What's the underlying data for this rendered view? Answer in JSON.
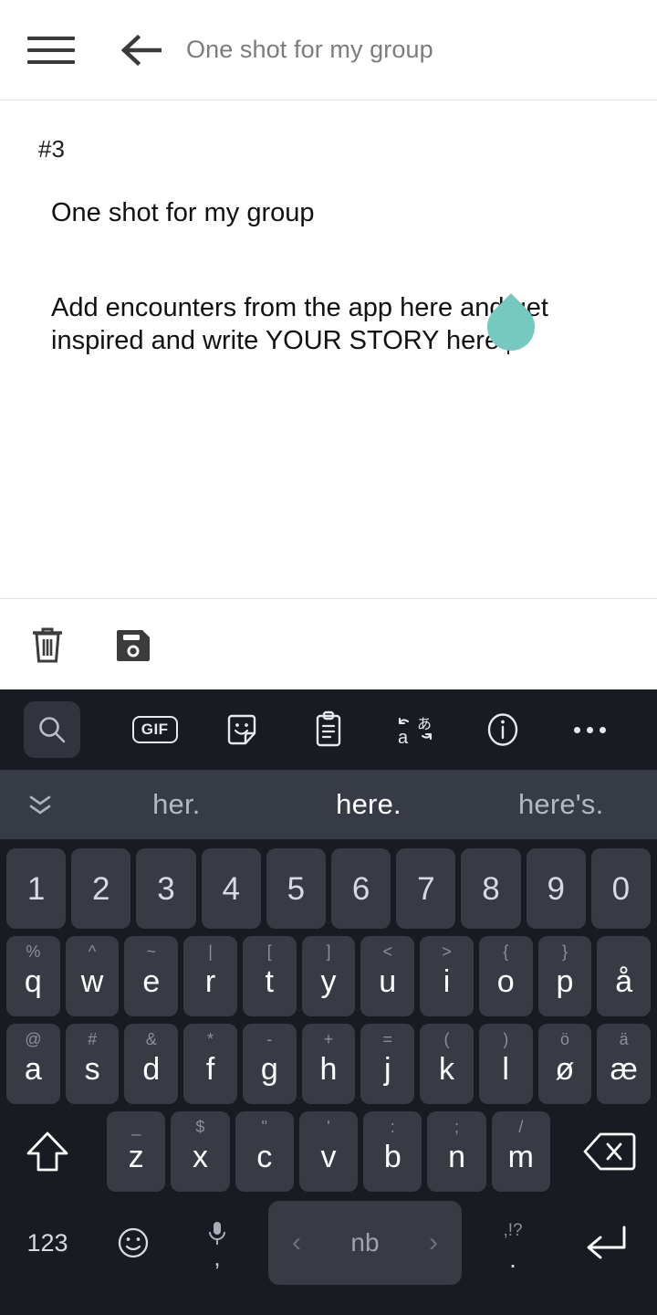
{
  "header": {
    "menu_icon": "hamburger-menu-icon",
    "back_icon": "back-arrow-icon",
    "title": "One shot for my group"
  },
  "document": {
    "index_label": "#3",
    "title": "One shot for my group",
    "body": "Add encounters from the app here and get inspired and write YOUR STORY here.",
    "cursor_handle_color": "#76c9bf",
    "toolbar": [
      {
        "name": "delete-button",
        "icon": "trash-icon"
      },
      {
        "name": "save-button",
        "icon": "floppy-disk-save-icon"
      }
    ]
  },
  "keyboard": {
    "background_color": "#191b22",
    "key_color": "#383b44",
    "toolbar": [
      {
        "name": "search-button",
        "icon": "search-icon",
        "active": true
      },
      {
        "name": "gif-button",
        "icon": "gif-icon",
        "label": "GIF"
      },
      {
        "name": "sticker-button",
        "icon": "sticker-icon"
      },
      {
        "name": "clipboard-button",
        "icon": "clipboard-icon"
      },
      {
        "name": "translate-button",
        "icon": "translate-icon"
      },
      {
        "name": "info-button",
        "icon": "info-icon"
      },
      {
        "name": "more-options-button",
        "icon": "overflow-menu-icon"
      }
    ],
    "suggestions": {
      "close_icon": "collapse-icon",
      "items": [
        {
          "text": "her.",
          "current": false
        },
        {
          "text": "here.",
          "current": true
        },
        {
          "text": "here's.",
          "current": false
        }
      ]
    },
    "rows": {
      "numbers": [
        {
          "main": "1"
        },
        {
          "main": "2"
        },
        {
          "main": "3"
        },
        {
          "main": "4"
        },
        {
          "main": "5"
        },
        {
          "main": "6"
        },
        {
          "main": "7"
        },
        {
          "main": "8"
        },
        {
          "main": "9"
        },
        {
          "main": "0"
        }
      ],
      "top": [
        {
          "main": "q",
          "sec": "%"
        },
        {
          "main": "w",
          "sec": "^"
        },
        {
          "main": "e",
          "sec": "~"
        },
        {
          "main": "r",
          "sec": "|"
        },
        {
          "main": "t",
          "sec": "["
        },
        {
          "main": "y",
          "sec": "]"
        },
        {
          "main": "u",
          "sec": "<"
        },
        {
          "main": "i",
          "sec": ">"
        },
        {
          "main": "o",
          "sec": "{"
        },
        {
          "main": "p",
          "sec": "}"
        },
        {
          "main": "å",
          "sec": ""
        }
      ],
      "home": [
        {
          "main": "a",
          "sec": "@"
        },
        {
          "main": "s",
          "sec": "#"
        },
        {
          "main": "d",
          "sec": "&"
        },
        {
          "main": "f",
          "sec": "*"
        },
        {
          "main": "g",
          "sec": "-"
        },
        {
          "main": "h",
          "sec": "+"
        },
        {
          "main": "j",
          "sec": "="
        },
        {
          "main": "k",
          "sec": "("
        },
        {
          "main": "l",
          "sec": ")"
        },
        {
          "main": "ø",
          "sec": "ö"
        },
        {
          "main": "æ",
          "sec": "ä"
        }
      ],
      "bottom": [
        {
          "main": "z",
          "sec": "_"
        },
        {
          "main": "x",
          "sec": "$"
        },
        {
          "main": "c",
          "sec": "\""
        },
        {
          "main": "v",
          "sec": "'"
        },
        {
          "main": "b",
          "sec": ":"
        },
        {
          "main": "n",
          "sec": ";"
        },
        {
          "main": "m",
          "sec": "/"
        }
      ],
      "shift_icon": "shift-arrow-icon",
      "backspace_icon": "backspace-icon"
    },
    "bottom_row": {
      "numeric_label": "123",
      "emoji_icon": "emoji-smiley-icon",
      "mic_icon": "microphone-icon",
      "comma_label": ",",
      "space_label": "nb",
      "prev_lang_icon": "chevron-left-icon",
      "next_lang_icon": "chevron-right-icon",
      "period_secondary": ",!?",
      "period_label": ".",
      "enter_icon": "enter-return-icon"
    }
  }
}
